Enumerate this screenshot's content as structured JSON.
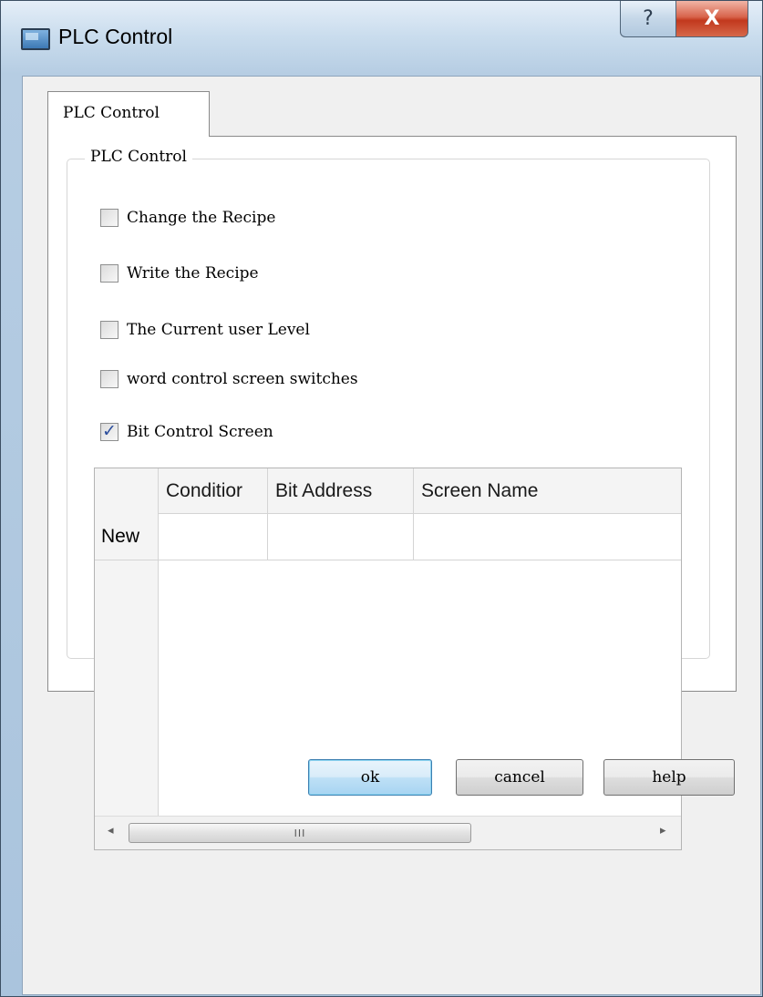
{
  "window": {
    "title": "PLC Control",
    "help_glyph": "?",
    "close_glyph": "X"
  },
  "tab": {
    "label": "PLC Control"
  },
  "group": {
    "label": "PLC Control"
  },
  "options": [
    {
      "label": "Change the Recipe",
      "checked": false
    },
    {
      "label": "Write the Recipe",
      "checked": false
    },
    {
      "label": "The Current user Level",
      "checked": false
    },
    {
      "label": "word control screen switches",
      "checked": false
    },
    {
      "label": "Bit Control Screen",
      "checked": true
    }
  ],
  "table": {
    "columns": [
      "Conditior",
      "Bit Address",
      "Screen Name"
    ],
    "new_row_label": "New",
    "scroll_left": "◂",
    "scroll_right": "▸",
    "scroll_grip": "III"
  },
  "buttons": {
    "ok": "ok",
    "cancel": "cancel",
    "help": "help"
  }
}
